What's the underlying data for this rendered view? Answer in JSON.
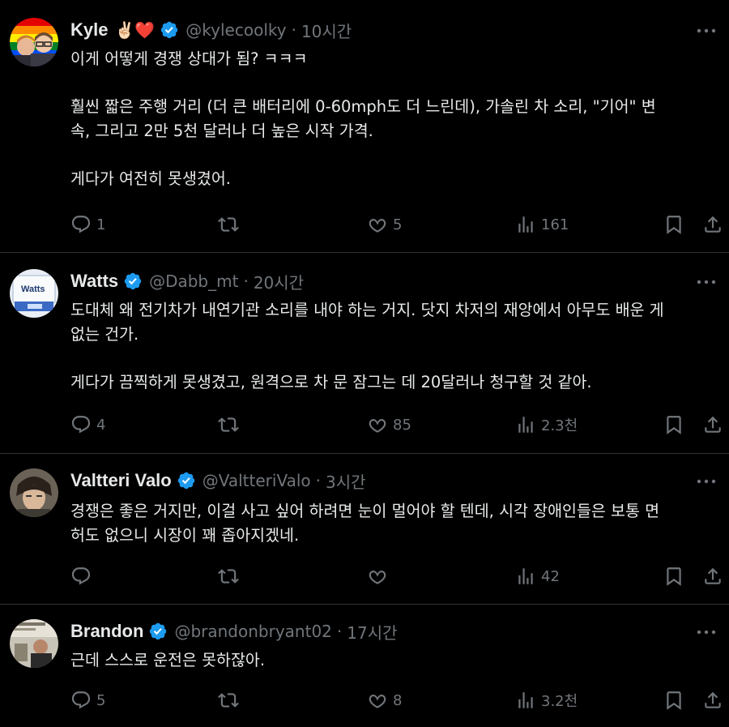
{
  "tweets": [
    {
      "name": "Kyle",
      "emoji": "✌🏻❤️",
      "handle": "@kylecoolky",
      "time": "10시간",
      "lines": [
        "이게 어떻게 경쟁 상대가 됨? ㅋㅋㅋ",
        "",
        "훨씬 짧은 주행 거리 (더 큰 배터리에 0-60mph도 더 느린데), 가솔린 차 소리, \"기어\" 변",
        "속, 그리고 2만 5천 달러나 더 높은 시작 가격.",
        "",
        "게다가 여전히 못생겼어."
      ],
      "replies": "1",
      "retweets": "",
      "likes": "5",
      "views": "161"
    },
    {
      "name": "Watts",
      "handle": "@Dabb_mt",
      "time": "20시간",
      "avatar_text": "Watts",
      "lines": [
        "도대체 왜 전기차가 내연기관 소리를 내야 하는 거지. 닷지 차저의 재앙에서 아무도 배운 게",
        "없는 건가.",
        "",
        "게다가 끔찍하게 못생겼고, 원격으로 차 문 잠그는 데 20달러나 청구할 것 같아."
      ],
      "replies": "4",
      "retweets": "",
      "likes": "85",
      "views": "2.3천"
    },
    {
      "name": "Valtteri Valo",
      "handle": "@ValtteriValo",
      "time": "3시간",
      "lines": [
        "경쟁은 좋은 거지만, 이걸 사고 싶어 하려면 눈이 멀어야 할 텐데, 시각 장애인들은 보통 면",
        "허도 없으니 시장이 꽤 좁아지겠네."
      ],
      "replies": "",
      "retweets": "",
      "likes": "",
      "views": "42"
    },
    {
      "name": "Brandon",
      "handle": "@brandonbryant02",
      "time": "17시간",
      "lines": [
        "근데 스스로 운전은 못하잖아."
      ],
      "replies": "5",
      "retweets": "",
      "likes": "8",
      "views": "3.2천"
    }
  ],
  "sep": "·",
  "more_icon": "more-horizontal-icon",
  "colors": {
    "bg": "#000000",
    "text": "#e7e9ea",
    "muted": "#71767b",
    "verified": "#1d9bf0",
    "border": "#2f3336",
    "heart": "#e0245e"
  }
}
